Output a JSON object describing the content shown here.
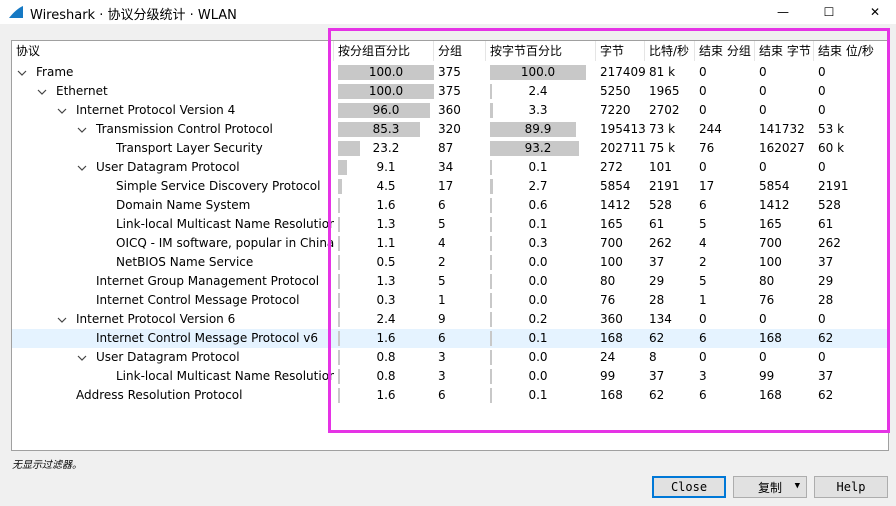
{
  "window": {
    "title": "Wireshark · 协议分级统计 · WLAN",
    "minimize_glyph": "—",
    "maximize_glyph": "☐",
    "close_glyph": "✕"
  },
  "columns": [
    "协议",
    "按分组百分比",
    "分组",
    "按字节百分比",
    "字节",
    "比特/秒",
    "结束 分组",
    "结束 字节",
    "结束 位/秒"
  ],
  "rows": [
    {
      "name": "Frame",
      "level": 0,
      "expandable": true,
      "pkt_pct": "100.0",
      "pkt_pct_value": 100.0,
      "pkts": "375",
      "byte_pct": "100.0",
      "byte_pct_value": 100.0,
      "bytes": "217409",
      "bps": "81 k",
      "end_pkts": "0",
      "end_bytes": "0",
      "end_bps": "0"
    },
    {
      "name": "Ethernet",
      "level": 1,
      "expandable": true,
      "pkt_pct": "100.0",
      "pkt_pct_value": 100.0,
      "pkts": "375",
      "byte_pct": "2.4",
      "byte_pct_value": 2.4,
      "bytes": "5250",
      "bps": "1965",
      "end_pkts": "0",
      "end_bytes": "0",
      "end_bps": "0"
    },
    {
      "name": "Internet Protocol Version 4",
      "level": 2,
      "expandable": true,
      "pkt_pct": "96.0",
      "pkt_pct_value": 96.0,
      "pkts": "360",
      "byte_pct": "3.3",
      "byte_pct_value": 3.3,
      "bytes": "7220",
      "bps": "2702",
      "end_pkts": "0",
      "end_bytes": "0",
      "end_bps": "0"
    },
    {
      "name": "Transmission Control Protocol",
      "level": 3,
      "expandable": true,
      "pkt_pct": "85.3",
      "pkt_pct_value": 85.3,
      "pkts": "320",
      "byte_pct": "89.9",
      "byte_pct_value": 89.9,
      "bytes": "195413",
      "bps": "73 k",
      "end_pkts": "244",
      "end_bytes": "141732",
      "end_bps": "53 k"
    },
    {
      "name": "Transport Layer Security",
      "level": 4,
      "expandable": false,
      "pkt_pct": "23.2",
      "pkt_pct_value": 23.2,
      "pkts": "87",
      "byte_pct": "93.2",
      "byte_pct_value": 93.2,
      "bytes": "202711",
      "bps": "75 k",
      "end_pkts": "76",
      "end_bytes": "162027",
      "end_bps": "60 k"
    },
    {
      "name": "User Datagram Protocol",
      "level": 3,
      "expandable": true,
      "pkt_pct": "9.1",
      "pkt_pct_value": 9.1,
      "pkts": "34",
      "byte_pct": "0.1",
      "byte_pct_value": 0.1,
      "bytes": "272",
      "bps": "101",
      "end_pkts": "0",
      "end_bytes": "0",
      "end_bps": "0"
    },
    {
      "name": "Simple Service Discovery Protocol",
      "level": 4,
      "expandable": false,
      "pkt_pct": "4.5",
      "pkt_pct_value": 4.5,
      "pkts": "17",
      "byte_pct": "2.7",
      "byte_pct_value": 2.7,
      "bytes": "5854",
      "bps": "2191",
      "end_pkts": "17",
      "end_bytes": "5854",
      "end_bps": "2191"
    },
    {
      "name": "Domain Name System",
      "level": 4,
      "expandable": false,
      "pkt_pct": "1.6",
      "pkt_pct_value": 1.6,
      "pkts": "6",
      "byte_pct": "0.6",
      "byte_pct_value": 0.6,
      "bytes": "1412",
      "bps": "528",
      "end_pkts": "6",
      "end_bytes": "1412",
      "end_bps": "528"
    },
    {
      "name": "Link-local Multicast Name Resolution",
      "level": 4,
      "expandable": false,
      "pkt_pct": "1.3",
      "pkt_pct_value": 1.3,
      "pkts": "5",
      "byte_pct": "0.1",
      "byte_pct_value": 0.1,
      "bytes": "165",
      "bps": "61",
      "end_pkts": "5",
      "end_bytes": "165",
      "end_bps": "61"
    },
    {
      "name": "OICQ - IM software, popular in China",
      "level": 4,
      "expandable": false,
      "pkt_pct": "1.1",
      "pkt_pct_value": 1.1,
      "pkts": "4",
      "byte_pct": "0.3",
      "byte_pct_value": 0.3,
      "bytes": "700",
      "bps": "262",
      "end_pkts": "4",
      "end_bytes": "700",
      "end_bps": "262"
    },
    {
      "name": "NetBIOS Name Service",
      "level": 4,
      "expandable": false,
      "pkt_pct": "0.5",
      "pkt_pct_value": 0.5,
      "pkts": "2",
      "byte_pct": "0.0",
      "byte_pct_value": 0.0,
      "bytes": "100",
      "bps": "37",
      "end_pkts": "2",
      "end_bytes": "100",
      "end_bps": "37"
    },
    {
      "name": "Internet Group Management Protocol",
      "level": 3,
      "expandable": false,
      "pkt_pct": "1.3",
      "pkt_pct_value": 1.3,
      "pkts": "5",
      "byte_pct": "0.0",
      "byte_pct_value": 0.0,
      "bytes": "80",
      "bps": "29",
      "end_pkts": "5",
      "end_bytes": "80",
      "end_bps": "29"
    },
    {
      "name": "Internet Control Message Protocol",
      "level": 3,
      "expandable": false,
      "pkt_pct": "0.3",
      "pkt_pct_value": 0.3,
      "pkts": "1",
      "byte_pct": "0.0",
      "byte_pct_value": 0.0,
      "bytes": "76",
      "bps": "28",
      "end_pkts": "1",
      "end_bytes": "76",
      "end_bps": "28"
    },
    {
      "name": "Internet Protocol Version 6",
      "level": 2,
      "expandable": true,
      "pkt_pct": "2.4",
      "pkt_pct_value": 2.4,
      "pkts": "9",
      "byte_pct": "0.2",
      "byte_pct_value": 0.2,
      "bytes": "360",
      "bps": "134",
      "end_pkts": "0",
      "end_bytes": "0",
      "end_bps": "0"
    },
    {
      "name": "Internet Control Message Protocol v6",
      "level": 3,
      "expandable": false,
      "selected": true,
      "pkt_pct": "1.6",
      "pkt_pct_value": 1.6,
      "pkts": "6",
      "byte_pct": "0.1",
      "byte_pct_value": 0.1,
      "bytes": "168",
      "bps": "62",
      "end_pkts": "6",
      "end_bytes": "168",
      "end_bps": "62"
    },
    {
      "name": "User Datagram Protocol",
      "level": 3,
      "expandable": true,
      "pkt_pct": "0.8",
      "pkt_pct_value": 0.8,
      "pkts": "3",
      "byte_pct": "0.0",
      "byte_pct_value": 0.0,
      "bytes": "24",
      "bps": "8",
      "end_pkts": "0",
      "end_bytes": "0",
      "end_bps": "0"
    },
    {
      "name": "Link-local Multicast Name Resolution",
      "level": 4,
      "expandable": false,
      "pkt_pct": "0.8",
      "pkt_pct_value": 0.8,
      "pkts": "3",
      "byte_pct": "0.0",
      "byte_pct_value": 0.0,
      "bytes": "99",
      "bps": "37",
      "end_pkts": "3",
      "end_bytes": "99",
      "end_bps": "37"
    },
    {
      "name": "Address Resolution Protocol",
      "level": 2,
      "expandable": false,
      "pkt_pct": "1.6",
      "pkt_pct_value": 1.6,
      "pkts": "6",
      "byte_pct": "0.1",
      "byte_pct_value": 0.1,
      "bytes": "168",
      "bps": "62",
      "end_pkts": "6",
      "end_bytes": "168",
      "end_bps": "62"
    }
  ],
  "status": {
    "filter_text": "无显示过滤器。"
  },
  "buttons": {
    "close": "Close",
    "copy": "复制",
    "help": "Help"
  },
  "colors": {
    "highlight_box": "#e533e5",
    "bar_fill": "#c8c8c8",
    "selected_row": "#e5f3ff"
  }
}
